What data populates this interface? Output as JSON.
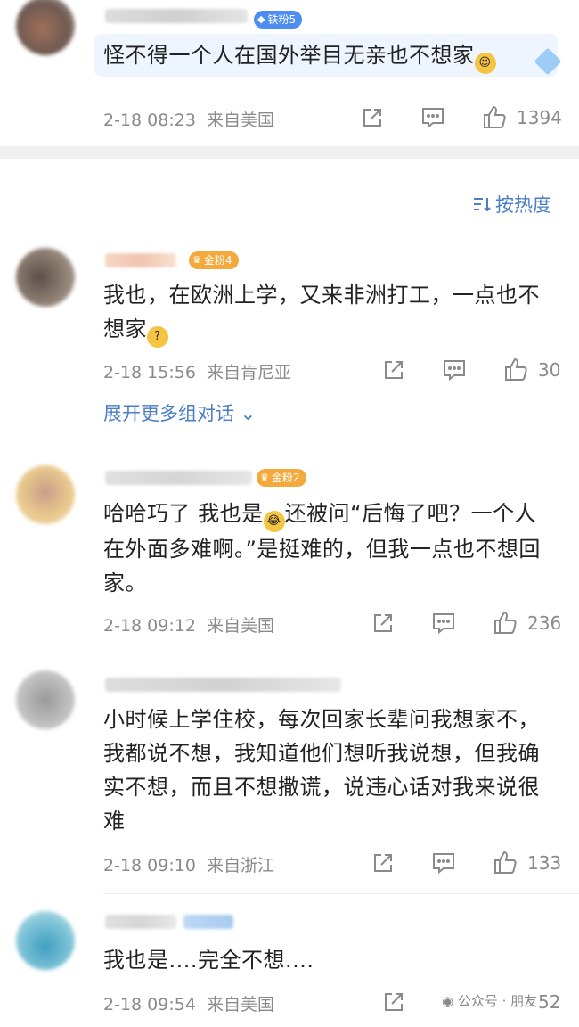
{
  "sort": {
    "icon": "sort-lines-icon",
    "label": "按热度"
  },
  "expand_label": "展开更多组对话",
  "watermark": "公众号 · 朋友",
  "comments": [
    {
      "badge": "铁粉5",
      "badge_icon": "diamond-icon",
      "text": "怪不得一个人在国外举目无亲也不想家",
      "time": "2-18 08:23",
      "location": "来自美国",
      "likes": "1394"
    },
    {
      "badge": "金粉4",
      "badge_icon": "crown-icon",
      "text": "我也，在欧洲上学，又来非洲打工，一点也不想家",
      "time": "2-18 15:56",
      "location": "来自肯尼亚",
      "likes": "30"
    },
    {
      "badge": "金粉2",
      "badge_icon": "crown-icon",
      "text": "哈哈巧了 我也是",
      "text2": "还被问“后悔了吧？一个人在外面多难啊。”是挺难的，但我一点也不想回家。",
      "time": "2-18 09:12",
      "location": "来自美国",
      "likes": "236"
    },
    {
      "text": "小时候上学住校，每次回家长辈问我想家不，我都说不想，我知道他们想听我说想，但我确实不想，而且不想撒谎，说违心话对我来说很难",
      "time": "2-18 09:10",
      "location": "来自浙江",
      "likes": "133"
    },
    {
      "text": "我也是....完全不想....",
      "time": "2-18 09:54",
      "location": "来自美国",
      "likes": "52"
    }
  ]
}
